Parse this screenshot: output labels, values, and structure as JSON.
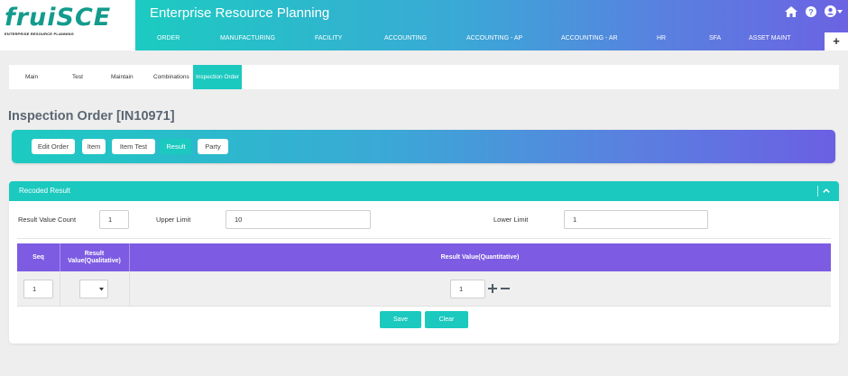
{
  "brand": {
    "logo": "fruiSCE",
    "tagline": "ENTERPRISE RESOURCE PLANNING"
  },
  "header": {
    "title": "Enterprise Resource Planning",
    "icons": [
      "home-icon",
      "help-icon",
      "user-icon"
    ],
    "accent": "#1bc9bf"
  },
  "nav": {
    "items": [
      "ORDER",
      "MANUFACTURING",
      "FACILITY",
      "ACCOUNTING",
      "ACCOUNTING - AP",
      "ACCOUNTING - AR",
      "HR",
      "SFA",
      "ASSET MAINT"
    ],
    "plus": "+"
  },
  "tabs": [
    "Main",
    "Test",
    "Maintain",
    "Combinations",
    "Inspection Order"
  ],
  "active_tab": "Inspection Order",
  "page": {
    "title": "Inspection Order [IN10971]"
  },
  "actions": [
    "Edit Order",
    "Item",
    "Item Test",
    "Result",
    "Party"
  ],
  "active_action": "Result",
  "section": {
    "title": "Recoded Result",
    "fields": {
      "count_label": "Result Value Count",
      "count_value": "1",
      "upper_label": "Upper Limit",
      "upper_value": "10",
      "lower_label": "Lower Limit",
      "lower_value": "1"
    },
    "table": {
      "headers": [
        "Seq",
        "Result Value(Qualitative)",
        "Result Value(Quantitative)"
      ],
      "rows": [
        {
          "seq": "1",
          "qualitative": "",
          "quantitative": "1"
        }
      ]
    },
    "buttons": {
      "save": "Save",
      "clear": "Clear"
    }
  }
}
